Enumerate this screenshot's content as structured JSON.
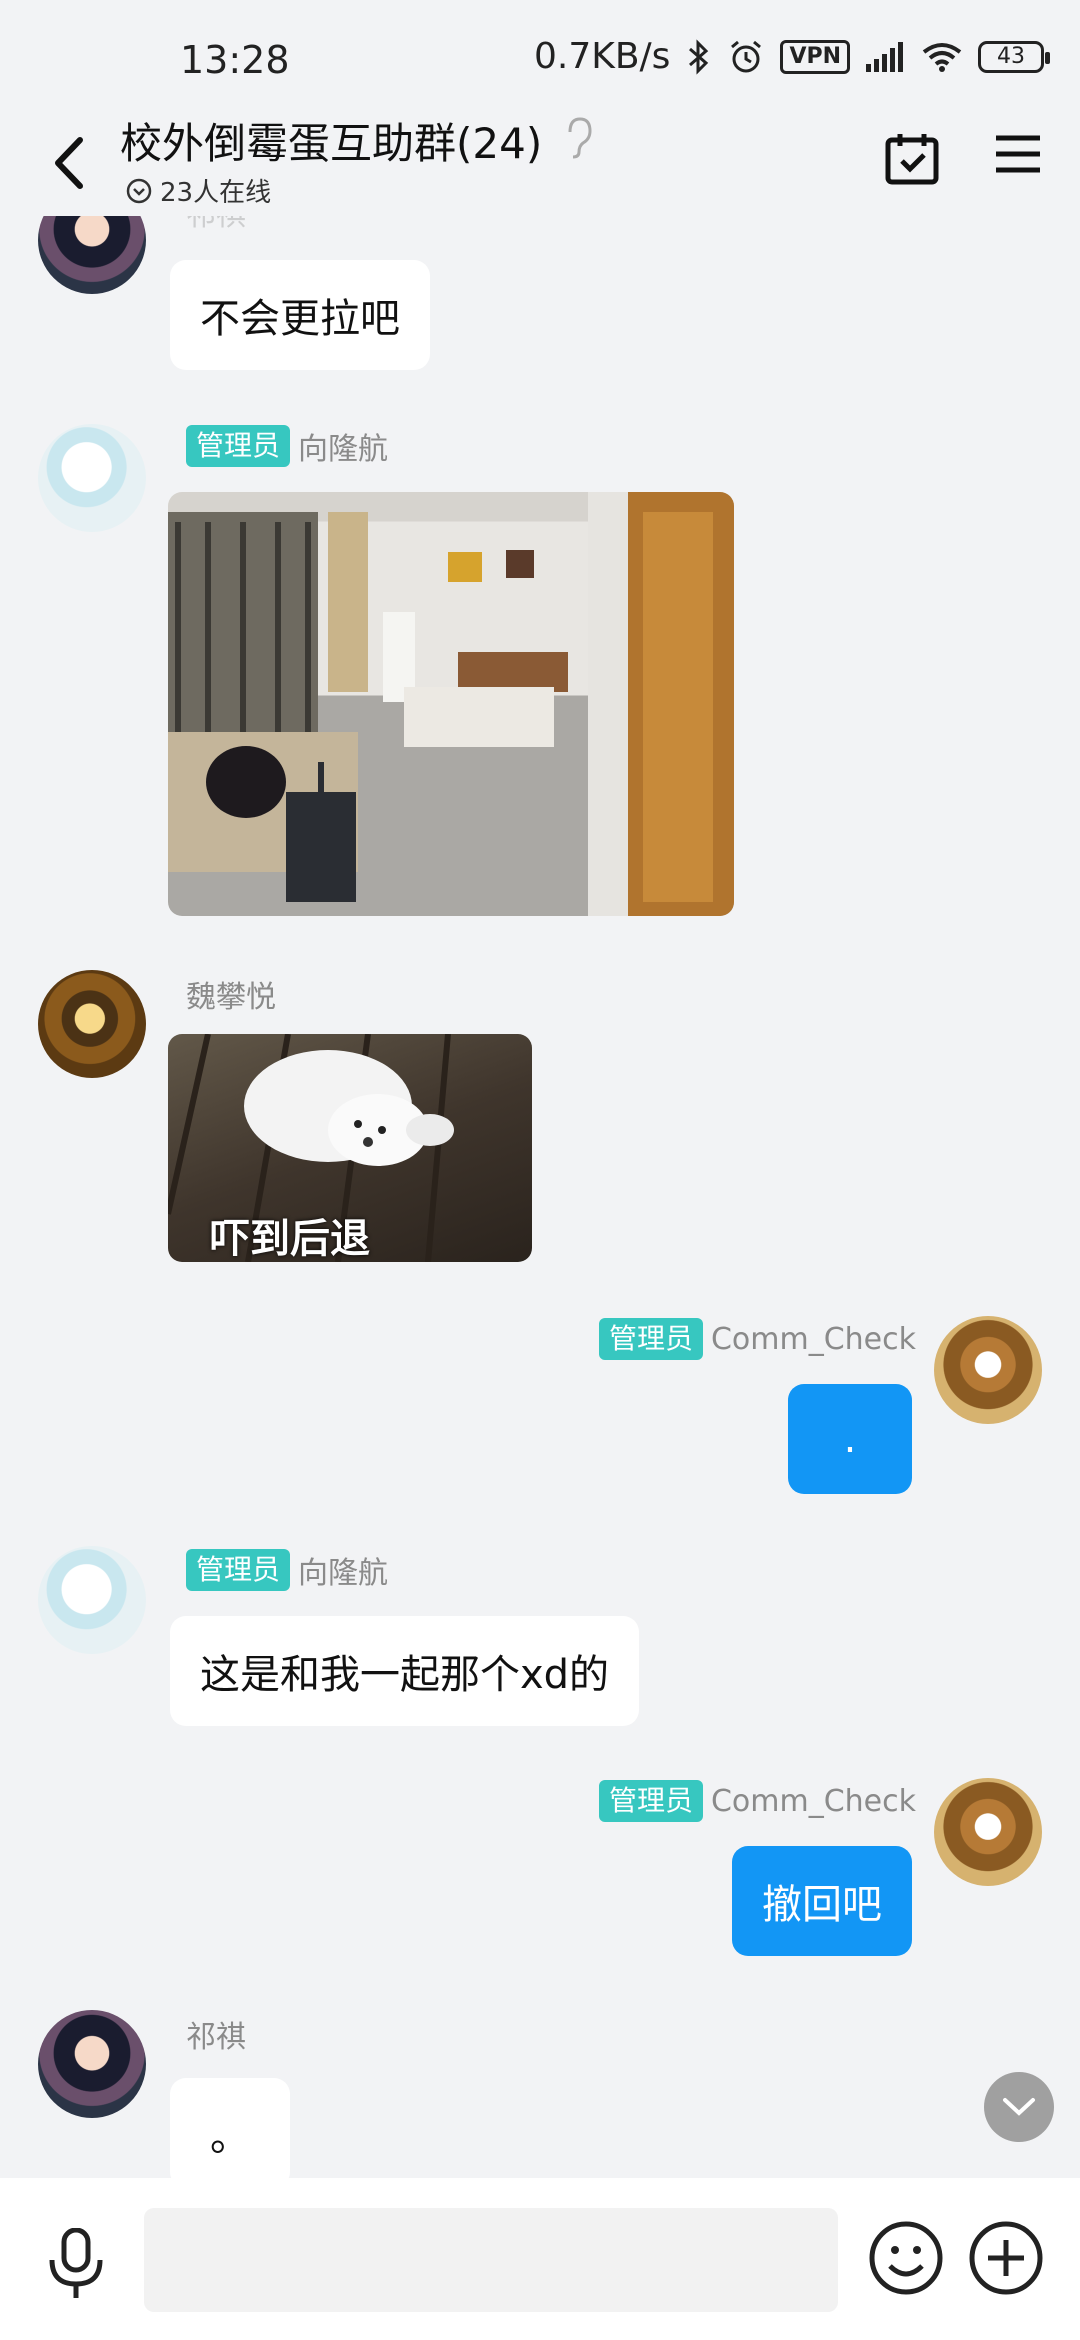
{
  "status_bar": {
    "time": "13:28",
    "network_speed": "0.7KB/s",
    "vpn": "VPN",
    "battery": "43"
  },
  "header": {
    "title": "校外倒霉蛋互助群(24)",
    "online": "23人在线"
  },
  "messages": [
    {
      "sender": "祁祺",
      "badge": "",
      "text": "不会更拉吧",
      "type": "text",
      "avatar_icon": "anime-girl-avatar"
    },
    {
      "sender": "向隆航",
      "badge": "管理员",
      "type": "image",
      "image_desc": "room-photo",
      "avatar_icon": "white-hair-anime-avatar"
    },
    {
      "sender": "魏攀悦",
      "badge": "",
      "type": "sticker",
      "sticker_text": "吓到后退",
      "avatar_icon": "dog-avatar"
    },
    {
      "sender": "Comm_Check",
      "badge": "管理员",
      "text": ".",
      "type": "text",
      "self": true,
      "avatar_icon": "cat-avatar"
    },
    {
      "sender": "向隆航",
      "badge": "管理员",
      "text": "这是和我一起那个xd的",
      "type": "text",
      "avatar_icon": "white-hair-anime-avatar"
    },
    {
      "sender": "Comm_Check",
      "badge": "管理员",
      "text": "撤回吧",
      "type": "text",
      "self": true,
      "avatar_icon": "cat-avatar"
    },
    {
      "sender": "祁祺",
      "badge": "",
      "text": "。",
      "type": "text",
      "avatar_icon": "anime-girl-avatar"
    }
  ],
  "input": {
    "placeholder": ""
  },
  "colors": {
    "self_bubble": "#1296f5",
    "badge": "#37c7c0",
    "background": "#f2f3f5"
  }
}
